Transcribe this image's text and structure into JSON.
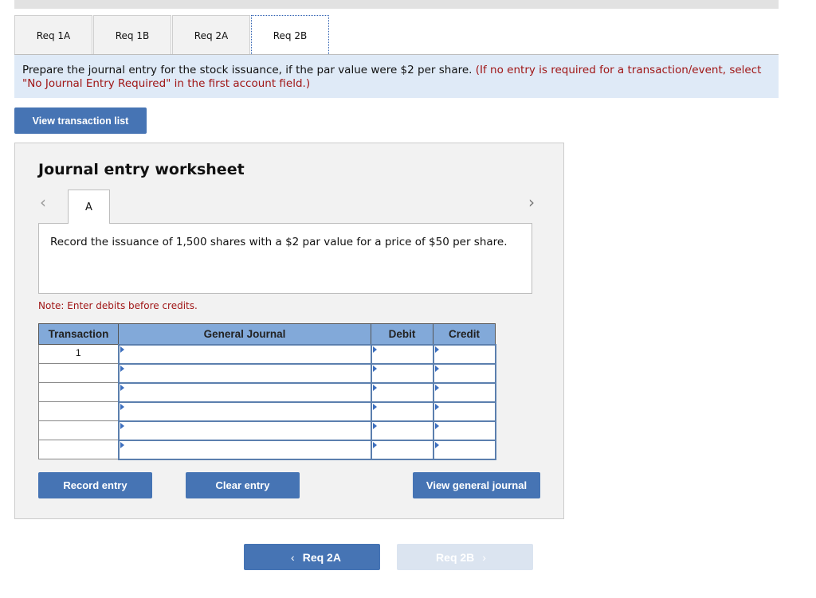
{
  "tabs": [
    {
      "label": "Req 1A",
      "active": false
    },
    {
      "label": "Req 1B",
      "active": false
    },
    {
      "label": "Req 2A",
      "active": false
    },
    {
      "label": "Req 2B",
      "active": true
    }
  ],
  "instructions": {
    "text": "Prepare the journal entry for the stock issuance, if the par value were $2 per share.",
    "note": "(If no entry is required for a transaction/event, select \"No Journal Entry Required\" in the first account field.)"
  },
  "view_transaction_list_label": "View transaction list",
  "worksheet": {
    "title": "Journal entry worksheet",
    "prev_icon": "chevron-left-icon",
    "next_icon": "chevron-right-icon",
    "entry_tab": "A",
    "description": "Record the issuance of 1,500 shares with a $2 par value for a price of $50 per share.",
    "note": "Note: Enter debits before credits.",
    "table": {
      "headers": [
        "Transaction",
        "General Journal",
        "Debit",
        "Credit"
      ],
      "rows": [
        {
          "transaction": "1",
          "account": "",
          "debit": "",
          "credit": ""
        },
        {
          "transaction": "",
          "account": "",
          "debit": "",
          "credit": ""
        },
        {
          "transaction": "",
          "account": "",
          "debit": "",
          "credit": ""
        },
        {
          "transaction": "",
          "account": "",
          "debit": "",
          "credit": ""
        },
        {
          "transaction": "",
          "account": "",
          "debit": "",
          "credit": ""
        },
        {
          "transaction": "",
          "account": "",
          "debit": "",
          "credit": ""
        }
      ]
    },
    "buttons": {
      "record": "Record entry",
      "clear": "Clear entry",
      "view_general_journal": "View general journal"
    }
  },
  "bottom_nav": {
    "prev_label": "Req 2A",
    "next_label": "Req 2B",
    "next_disabled": true
  },
  "colors": {
    "button_blue": "#4674b4",
    "header_blue": "#82a9d9",
    "instruction_bg": "#dfeaf7",
    "note_red": "#a01616"
  }
}
